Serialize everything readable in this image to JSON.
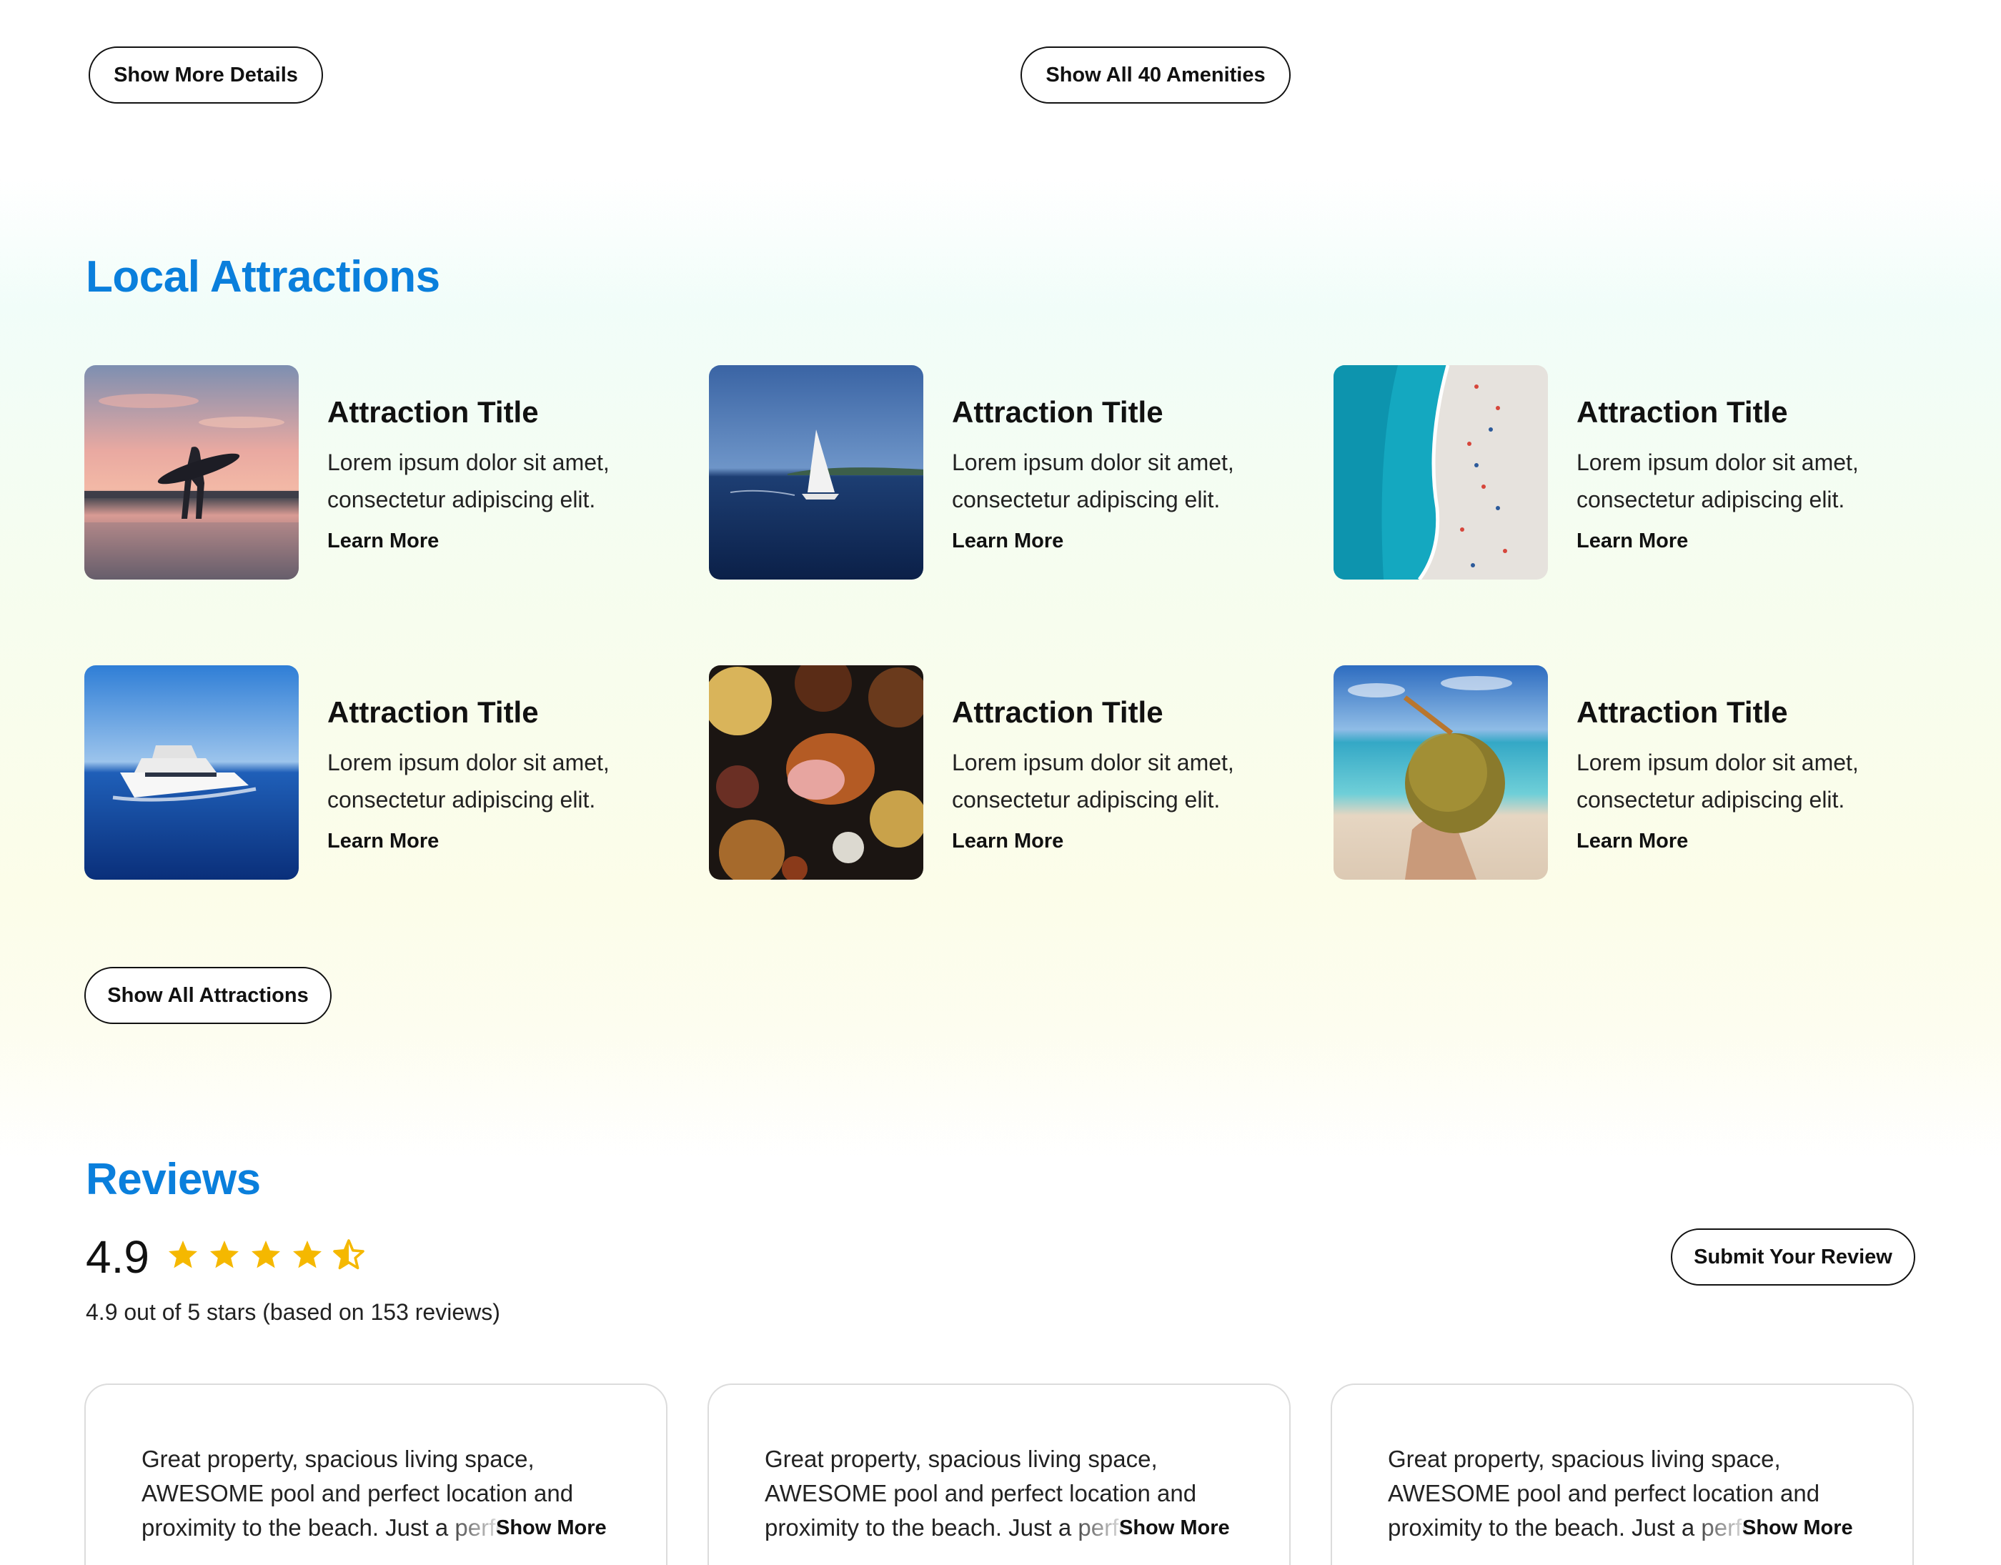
{
  "top_buttons": {
    "details": "Show More Details",
    "amenities": "Show All 40 Amenities"
  },
  "attractions": {
    "heading": "Local Attractions",
    "items": [
      {
        "title": "Attraction Title",
        "desc": "Lorem ipsum dolor sit amet, consectetur adipiscing elit.",
        "link": "Learn More",
        "image": "surfer-sunset-beach"
      },
      {
        "title": "Attraction Title",
        "desc": "Lorem ipsum dolor sit amet, consectetur adipiscing elit.",
        "link": "Learn More",
        "image": "sailboat-on-sea"
      },
      {
        "title": "Attraction Title",
        "desc": "Lorem ipsum dolor sit amet, consectetur adipiscing elit.",
        "link": "Learn More",
        "image": "aerial-beach"
      },
      {
        "title": "Attraction Title",
        "desc": "Lorem ipsum dolor sit amet, consectetur adipiscing elit.",
        "link": "Learn More",
        "image": "yacht-cruising"
      },
      {
        "title": "Attraction Title",
        "desc": "Lorem ipsum dolor sit amet, consectetur adipiscing elit.",
        "link": "Learn More",
        "image": "food-spread"
      },
      {
        "title": "Attraction Title",
        "desc": "Lorem ipsum dolor sit amet, consectetur adipiscing elit.",
        "link": "Learn More",
        "image": "coconut-drink-beach"
      }
    ],
    "show_all": "Show All Attractions"
  },
  "reviews": {
    "heading": "Reviews",
    "rating": "4.9",
    "stars_value": 4.5,
    "summary": "4.9 out of 5 stars (based on 153 reviews)",
    "submit": "Submit Your Review",
    "cards": [
      {
        "text": "Great property, spacious living space, AWESOME pool and perfect location and proximity to the beach. Just a perfect",
        "more": "Show More"
      },
      {
        "text": "Great property, spacious living space, AWESOME pool and perfect location and proximity to the beach. Just a perfect",
        "more": "Show More"
      },
      {
        "text": "Great property, spacious living space, AWESOME pool and perfect location and proximity to the beach. Just a perfect",
        "more": "Show More"
      }
    ]
  },
  "colors": {
    "accent": "#0a7fdc",
    "star": "#f5b800",
    "text": "#111111"
  }
}
